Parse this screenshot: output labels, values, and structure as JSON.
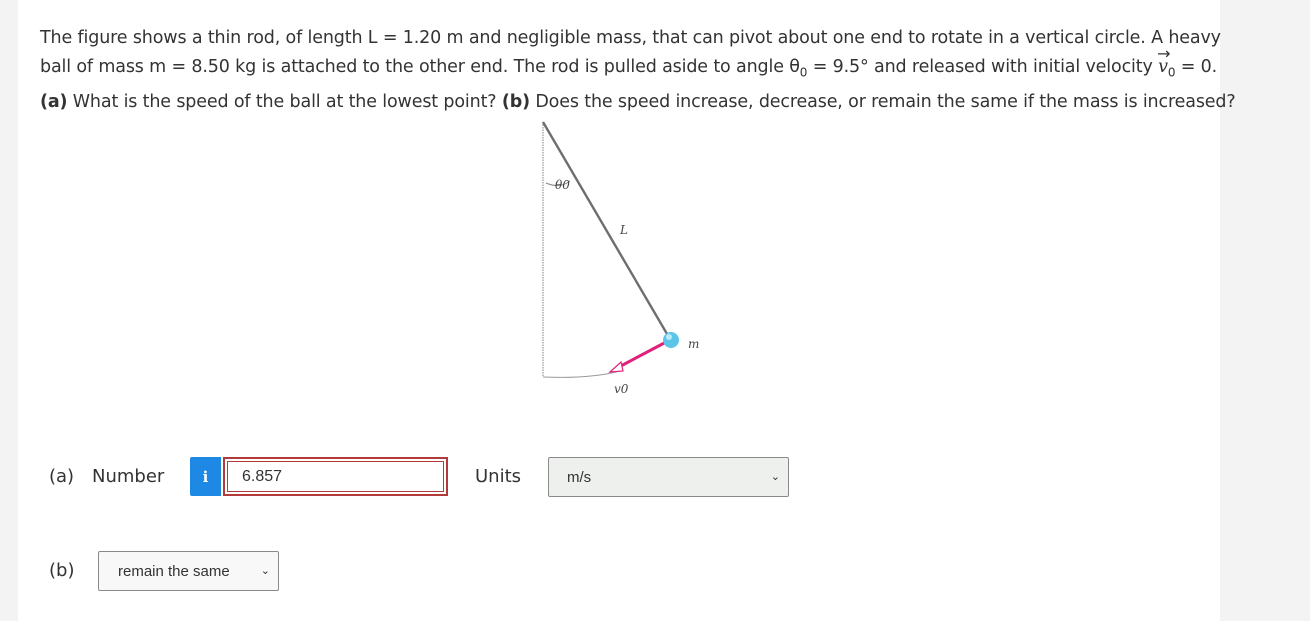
{
  "question": {
    "line1": "The figure shows a thin rod, of length L = 1.20 m and negligible mass, that can pivot about one end to rotate in a vertical circle. A heavy",
    "line2_pre": "ball of mass m = 8.50 kg is attached to the other end. The rod is pulled aside to angle θ",
    "line2_theta_sub": "0",
    "line2_mid": " = 9.5° and released with initial velocity ",
    "line2_vec": "v",
    "line2_vec_sub": "0",
    "line2_post": " = 0.",
    "part_a_tag": "(a)",
    "part_a_text": " What is the speed of the ball at the lowest point? ",
    "part_b_tag": "(b)",
    "part_b_text": " Does the speed increase, decrease, or remain the same if the mass is increased?"
  },
  "figure": {
    "theta_label": "θ0",
    "length_label": "L",
    "mass_label": "m",
    "velocity_label": "v0",
    "colors": {
      "rod": "#6e6e6e",
      "ball": "#5cc6e8",
      "velocity": "#e0207a",
      "guide": "#888888"
    }
  },
  "part_a": {
    "label": "(a)",
    "number_label": "Number",
    "info_icon": "i",
    "answer_value": "6.857",
    "units_label": "Units",
    "units_selected": "m/s"
  },
  "part_b": {
    "label": "(b)",
    "selected": "remain the same"
  }
}
